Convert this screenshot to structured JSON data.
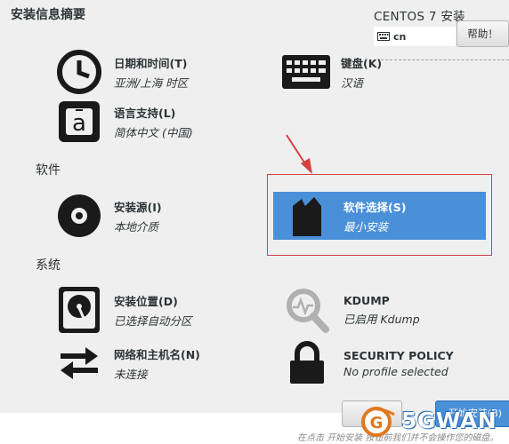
{
  "header": {
    "page_title": "安装信息摘要",
    "product_title": "CENTOS 7 安装",
    "keyboard_layout": "cn",
    "help_label": "帮助！"
  },
  "sections": {
    "localization": {
      "items": [
        {
          "title": "日期和时间(T)",
          "status": "亚洲/上海 时区",
          "icon": "clock-icon"
        },
        {
          "title": "键盘(K)",
          "status": "汉语",
          "icon": "keyboard-icon"
        },
        {
          "title": "语言支持(L)",
          "status": "简体中文 (中国)",
          "icon": "language-icon"
        }
      ]
    },
    "software": {
      "header": "软件",
      "items": [
        {
          "title": "安装源(I)",
          "status": "本地介质",
          "icon": "disc-icon"
        },
        {
          "title": "软件选择(S)",
          "status": "最小安装",
          "icon": "package-icon",
          "selected": true
        }
      ]
    },
    "system": {
      "header": "系统",
      "items": [
        {
          "title": "安装位置(D)",
          "status": "已选择自动分区",
          "icon": "harddisk-icon"
        },
        {
          "title": "KDUMP",
          "status": "已启用 Kdump",
          "icon": "kdump-icon"
        },
        {
          "title": "网络和主机名(N)",
          "status": "未连接",
          "icon": "network-icon"
        },
        {
          "title": "SECURITY POLICY",
          "status": "No profile selected",
          "icon": "lock-icon"
        }
      ]
    }
  },
  "footer": {
    "begin_label": "开始安装(B)",
    "hint": "在点击 开始安装 按钮前我们并不会操作您的磁盘。"
  },
  "watermark": {
    "text": "5GWAN"
  },
  "colors": {
    "selected_bg": "#4a90d9",
    "highlight_border": "#d64040",
    "background": "#efefef"
  }
}
